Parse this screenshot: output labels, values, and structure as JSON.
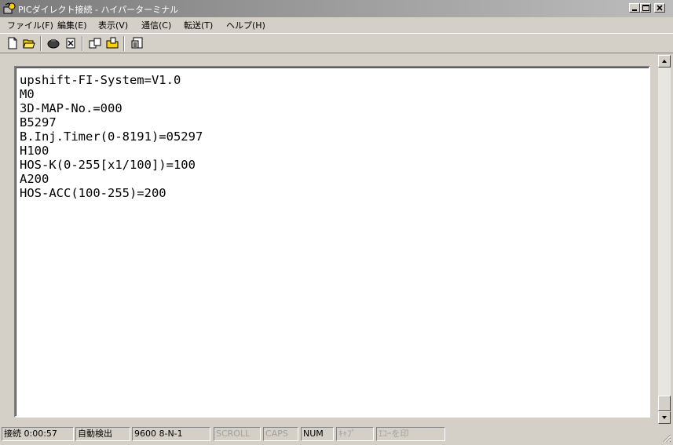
{
  "window": {
    "title": "PICダイレクト接続 - ハイパーターミナル",
    "icon": "hyperterminal-icon"
  },
  "menu": [
    {
      "label": "ファイル(F)"
    },
    {
      "label": "編集(E)"
    },
    {
      "label": "表示(V)"
    },
    {
      "label": "通信(C)"
    },
    {
      "label": "転送(T)"
    },
    {
      "label": "ヘルプ(H)"
    }
  ],
  "toolbar": [
    {
      "icon": "new-file-icon"
    },
    {
      "icon": "open-folder-icon"
    },
    {
      "icon": "connect-phone-icon"
    },
    {
      "icon": "disconnect-icon"
    },
    {
      "icon": "send-file-icon"
    },
    {
      "icon": "receive-file-icon"
    },
    {
      "icon": "properties-icon"
    }
  ],
  "terminal": {
    "lines": [
      "upshift-FI-System=V1.0",
      "M0",
      "3D-MAP-No.=000",
      "B5297",
      "B.Inj.Timer(0-8191)=05297",
      "H100",
      "HOS-K(0-255[x1/100])=100",
      "A200",
      "HOS-ACC(100-255)=200"
    ]
  },
  "statusbar": {
    "connected": "接続 0:00:57",
    "detect": "自動検出",
    "port": "9600 8-N-1",
    "scroll": "SCROLL",
    "caps": "CAPS",
    "num": "NUM",
    "capture": "ｷｬﾌﾟ",
    "echo": "ｴｺｰを印"
  },
  "colors": {
    "titlebar_inactive": "#808080",
    "face": "#d4d0c8",
    "terminal_bg": "#ffffff"
  }
}
